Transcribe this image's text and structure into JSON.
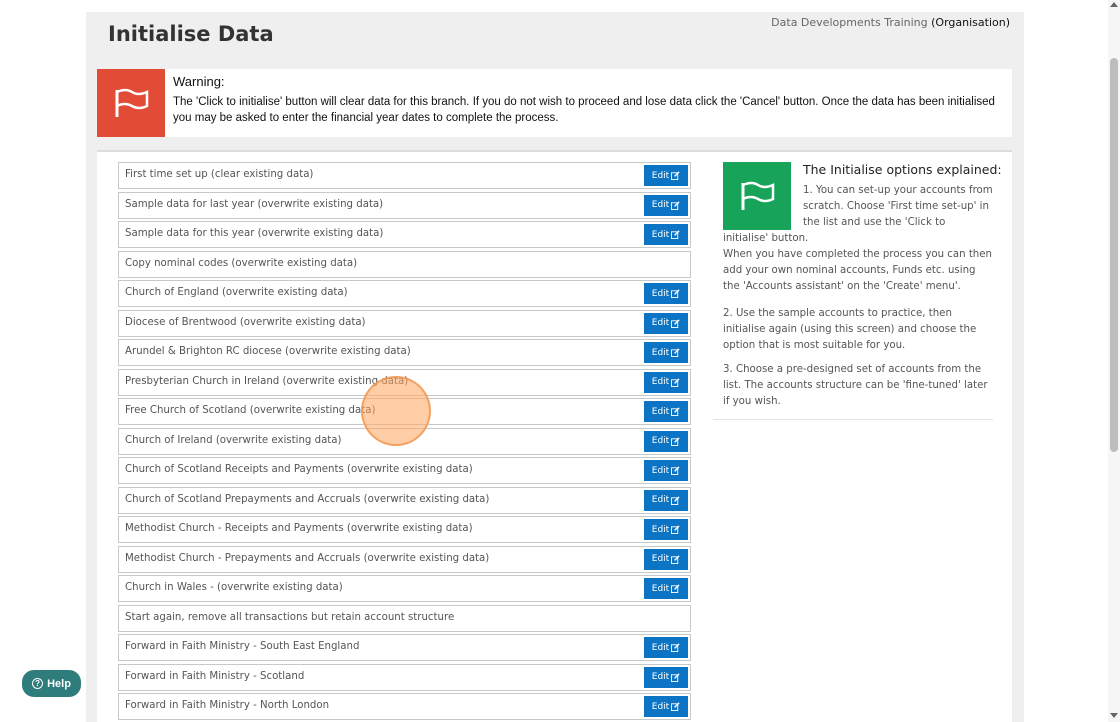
{
  "header": {
    "org_name": "Data Developments Training",
    "org_suffix": "(Organisation)",
    "title": "Initialise Data"
  },
  "warning": {
    "heading": "Warning:",
    "body": "The 'Click to initialise' button will clear data for this branch. If you do not wish to proceed and lose data click the 'Cancel' button. Once the data has been initialised you may be asked to enter the financial year dates to complete the process.",
    "color": "#e24b35",
    "icon": "flag-icon"
  },
  "options": [
    {
      "label": "First time set up (clear existing data)",
      "edit": "Edit"
    },
    {
      "label": "Sample data for last year (overwrite existing data)",
      "edit": "Edit"
    },
    {
      "label": "Sample data for this year (overwrite existing data)",
      "edit": "Edit"
    },
    {
      "label": "Copy nominal codes (overwrite existing data)",
      "edit": ""
    },
    {
      "label": "Church of England (overwrite existing data)",
      "edit": "Edit"
    },
    {
      "label": "Diocese of Brentwood (overwrite existing data)",
      "edit": "Edit"
    },
    {
      "label": "Arundel & Brighton RC diocese (overwrite existing data)",
      "edit": "Edit"
    },
    {
      "label": "Presbyterian Church in Ireland (overwrite existing data)",
      "edit": "Edit"
    },
    {
      "label": "Free Church of Scotland (overwrite existing data)",
      "edit": "Edit"
    },
    {
      "label": "Church of Ireland (overwrite existing data)",
      "edit": "Edit"
    },
    {
      "label": "Church of Scotland Receipts and Payments (overwrite existing data)",
      "edit": "Edit"
    },
    {
      "label": "Church of Scotland Prepayments and Accruals (overwrite existing data)",
      "edit": "Edit"
    },
    {
      "label": "Methodist Church - Receipts and Payments (overwrite existing data)",
      "edit": "Edit"
    },
    {
      "label": "Methodist Church - Prepayments and Accruals (overwrite existing data)",
      "edit": "Edit"
    },
    {
      "label": "Church in Wales - (overwrite existing data)",
      "edit": "Edit"
    },
    {
      "label": "Start again, remove all transactions but retain account structure",
      "edit": ""
    },
    {
      "label": "Forward in Faith Ministry - South East England",
      "edit": "Edit"
    },
    {
      "label": "Forward in Faith Ministry - Scotland",
      "edit": "Edit"
    },
    {
      "label": "Forward in Faith Ministry - North London",
      "edit": "Edit"
    }
  ],
  "explain": {
    "title": "The Initialise options explained:",
    "p1a": "1. You can set-up your accounts from scratch. Choose 'First time set-up' in the list and use the 'Click to",
    "p1b": "initialise' button.\nWhen you have completed the process you can then add your own nominal accounts, Funds etc. using the 'Accounts assistant' on the 'Create' menu'.",
    "p2": "2. Use the sample accounts to practice, then initialise again (using this screen) and choose the option that is most suitable for you.",
    "p3": "3. Choose a pre-designed set of accounts from the list. The accounts structure can be 'fine-tuned' later if you wish.",
    "color": "#17a35a",
    "icon": "flag-icon"
  },
  "help": {
    "label": "Help",
    "icon": "question-circle-icon",
    "color": "#2e7d7c"
  },
  "colors": {
    "edit_button": "#0b74c4"
  }
}
